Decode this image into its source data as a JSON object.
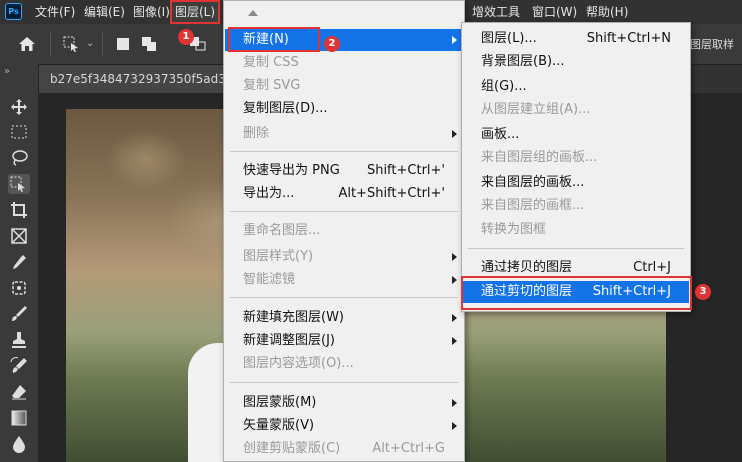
{
  "app": {
    "logo": "Ps"
  },
  "menubar": {
    "items": [
      "文件(F)",
      "编辑(E)",
      "图像(I)",
      "图层(L)",
      "增效工具",
      "窗口(W)",
      "帮助(H)"
    ]
  },
  "document": {
    "tab_title": "b27e5f3484732937350f5ad30"
  },
  "side_panel": {
    "label": "图层取样"
  },
  "layer_menu": {
    "items": [
      {
        "label": "新建(N)",
        "shortcut": "",
        "submenu": true,
        "disabled": false,
        "highlighted": true
      },
      {
        "label": "复制 CSS",
        "shortcut": "",
        "disabled": true
      },
      {
        "label": "复制 SVG",
        "shortcut": "",
        "disabled": true
      },
      {
        "label": "复制图层(D)...",
        "shortcut": "",
        "disabled": false
      },
      {
        "label": "删除",
        "shortcut": "",
        "submenu": true,
        "disabled": true
      },
      {
        "label": "快速导出为 PNG",
        "shortcut": "Shift+Ctrl+'",
        "disabled": false
      },
      {
        "label": "导出为...",
        "shortcut": "Alt+Shift+Ctrl+'",
        "disabled": false
      },
      {
        "label": "重命名图层...",
        "shortcut": "",
        "disabled": true
      },
      {
        "label": "图层样式(Y)",
        "shortcut": "",
        "submenu": true,
        "disabled": true
      },
      {
        "label": "智能滤镜",
        "shortcut": "",
        "submenu": true,
        "disabled": true
      },
      {
        "label": "新建填充图层(W)",
        "shortcut": "",
        "submenu": true,
        "disabled": false
      },
      {
        "label": "新建调整图层(J)",
        "shortcut": "",
        "submenu": true,
        "disabled": false
      },
      {
        "label": "图层内容选项(O)...",
        "shortcut": "",
        "disabled": true
      },
      {
        "label": "图层蒙版(M)",
        "shortcut": "",
        "submenu": true,
        "disabled": false
      },
      {
        "label": "矢量蒙版(V)",
        "shortcut": "",
        "submenu": true,
        "disabled": false
      },
      {
        "label": "创建剪贴蒙版(C)",
        "shortcut": "Alt+Ctrl+G",
        "disabled": true
      }
    ]
  },
  "new_submenu": {
    "items": [
      {
        "label": "图层(L)...",
        "shortcut": "Shift+Ctrl+N",
        "disabled": false
      },
      {
        "label": "背景图层(B)...",
        "shortcut": "",
        "disabled": false
      },
      {
        "label": "组(G)...",
        "shortcut": "",
        "disabled": false
      },
      {
        "label": "从图层建立组(A)...",
        "shortcut": "",
        "disabled": true
      },
      {
        "label": "画板...",
        "shortcut": "",
        "disabled": false
      },
      {
        "label": "来自图层组的画板...",
        "shortcut": "",
        "disabled": true
      },
      {
        "label": "来自图层的画板...",
        "shortcut": "",
        "disabled": false
      },
      {
        "label": "来自图层的画框...",
        "shortcut": "",
        "disabled": true
      },
      {
        "label": "转换为图框",
        "shortcut": "",
        "disabled": true
      },
      {
        "label": "通过拷贝的图层",
        "shortcut": "Ctrl+J",
        "disabled": false
      },
      {
        "label": "通过剪切的图层",
        "shortcut": "Shift+Ctrl+J",
        "disabled": false,
        "highlighted": true
      }
    ]
  },
  "annotations": {
    "step1": "1",
    "step2": "2",
    "step3": "3",
    "color": "#e03434"
  },
  "colors": {
    "highlight": "#1473e6",
    "menubar": "#323232",
    "menu_bg": "#f0f0f0"
  }
}
